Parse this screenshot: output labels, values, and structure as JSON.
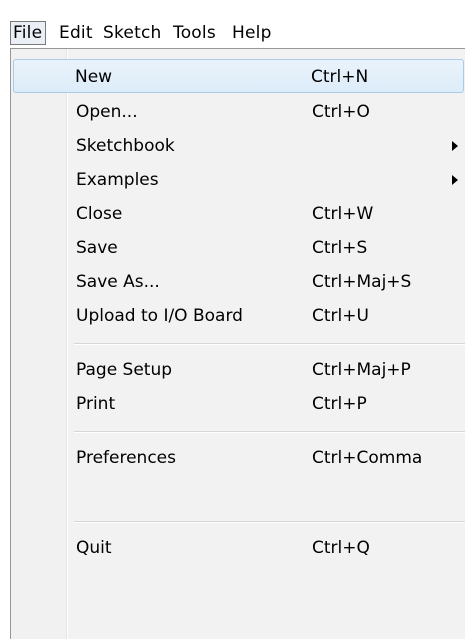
{
  "menubar": {
    "items": [
      {
        "label": "File"
      },
      {
        "label": "Edit"
      },
      {
        "label": "Sketch"
      },
      {
        "label": "Tools"
      },
      {
        "label": "Help"
      }
    ]
  },
  "file_menu": {
    "items": [
      {
        "label": "New",
        "shortcut": "Ctrl+N"
      },
      {
        "label": "Open...",
        "shortcut": "Ctrl+O"
      },
      {
        "label": "Sketchbook",
        "shortcut": ""
      },
      {
        "label": "Examples",
        "shortcut": ""
      },
      {
        "label": "Close",
        "shortcut": "Ctrl+W"
      },
      {
        "label": "Save",
        "shortcut": "Ctrl+S"
      },
      {
        "label": "Save As...",
        "shortcut": "Ctrl+Maj+S"
      },
      {
        "label": "Upload to I/O Board",
        "shortcut": "Ctrl+U"
      },
      {
        "label": "Page Setup",
        "shortcut": "Ctrl+Maj+P"
      },
      {
        "label": "Print",
        "shortcut": "Ctrl+P"
      },
      {
        "label": "Preferences",
        "shortcut": "Ctrl+Comma"
      },
      {
        "label": "Quit",
        "shortcut": "Ctrl+Q"
      }
    ]
  }
}
